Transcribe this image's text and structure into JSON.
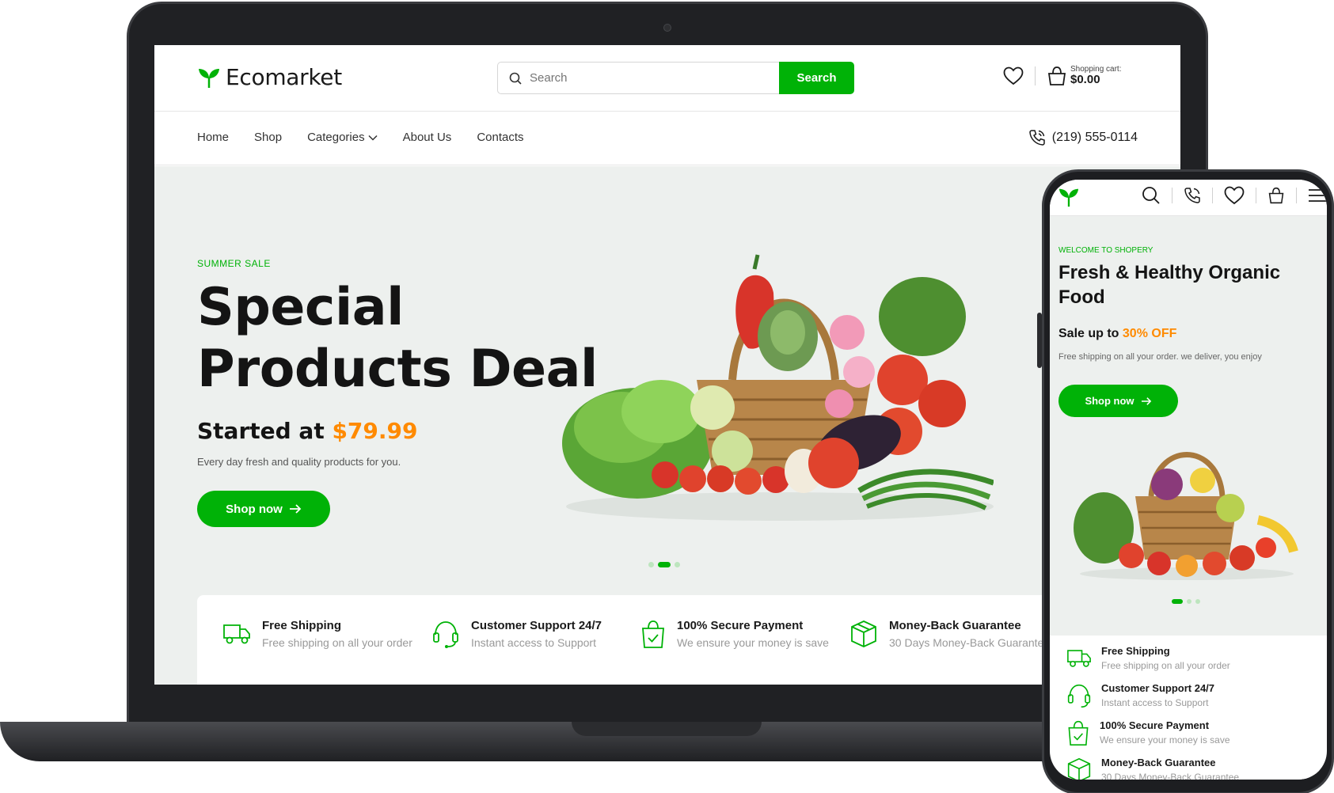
{
  "brand": {
    "name": "Ecomarket",
    "accent": "#00b207",
    "price_color": "#ff8a00"
  },
  "header": {
    "search_placeholder": "Search",
    "search_button": "Search",
    "cart_label": "Shopping cart:",
    "cart_amount": "$0.00"
  },
  "nav": {
    "items": [
      "Home",
      "Shop",
      "Categories",
      "About Us",
      "Contacts"
    ],
    "phone": "(219) 555-0114"
  },
  "hero": {
    "eyebrow": "SUMMER SALE",
    "headline": "Special Products Deal",
    "started_prefix": "Started at",
    "price": "$79.99",
    "subtitle": "Every day fresh and quality products for you.",
    "cta": "Shop now"
  },
  "features": [
    {
      "title": "Free Shipping",
      "desc": "Free shipping on all your order",
      "icon": "truck-icon"
    },
    {
      "title": "Customer Support 24/7",
      "desc": "Instant access to Support",
      "icon": "headset-icon"
    },
    {
      "title": "100% Secure Payment",
      "desc": "We ensure your money is save",
      "icon": "secure-bag-icon"
    },
    {
      "title": "Money-Back Guarantee",
      "desc": "30 Days Money-Back Guarantee",
      "icon": "box-icon"
    }
  ],
  "mobile": {
    "eyebrow": "WELCOME TO SHOPERY",
    "headline": "Fresh & Healthy Organic Food",
    "sale_prefix": "Sale up to",
    "sale_value": "30% OFF",
    "subtitle": "Free shipping on all your order. we deliver, you enjoy",
    "cta": "Shop now"
  }
}
